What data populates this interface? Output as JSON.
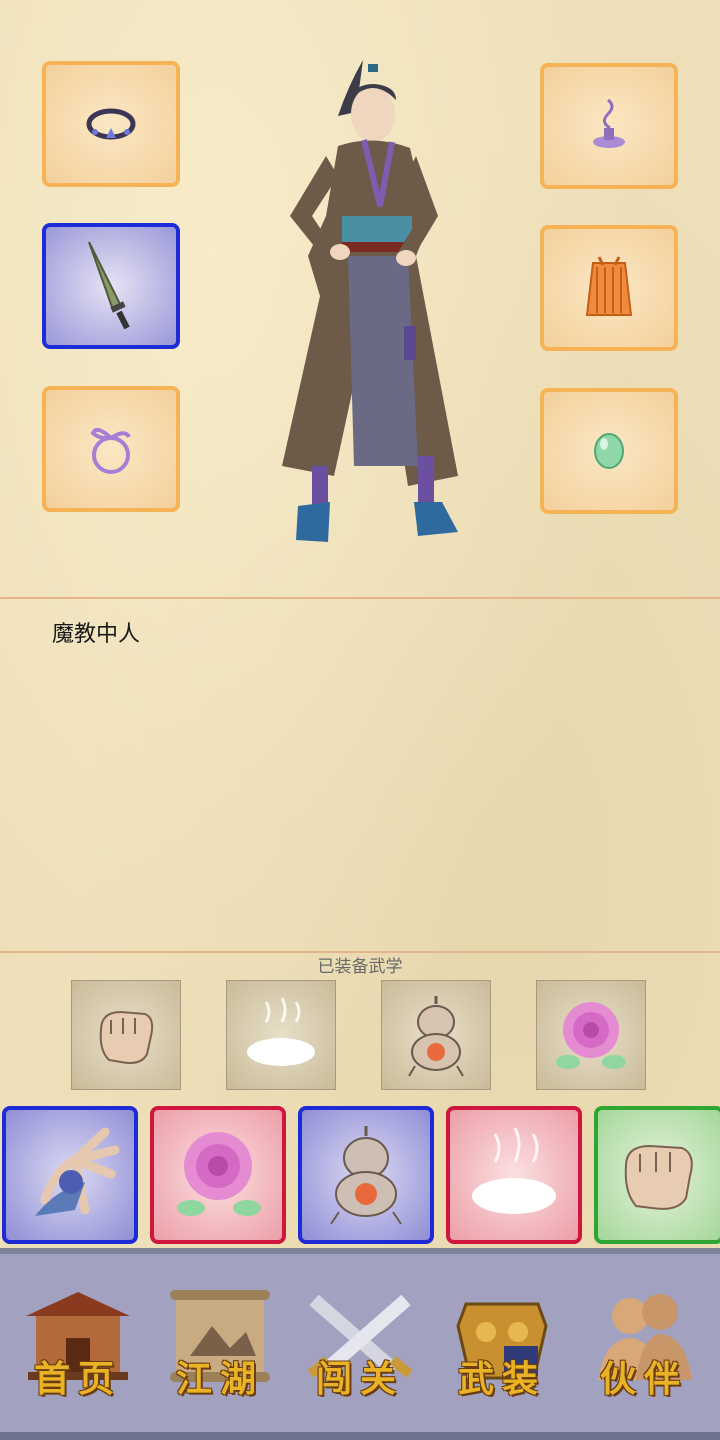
{
  "character": {
    "title": "魔教中人"
  },
  "equipment": {
    "left_slots": [
      {
        "icon": "ring-icon",
        "selected": false
      },
      {
        "icon": "sword-icon",
        "selected": true
      },
      {
        "icon": "ribbon-icon",
        "selected": false
      }
    ],
    "right_slots": [
      {
        "icon": "incense-icon",
        "selected": false
      },
      {
        "icon": "robe-icon",
        "selected": false
      },
      {
        "icon": "jade-bead-icon",
        "selected": false
      }
    ]
  },
  "martial_arts": {
    "label": "已装备武学",
    "equipped": [
      "fist-icon",
      "mist-icon",
      "gourd-icon",
      "peony-icon"
    ]
  },
  "skill_cards": [
    {
      "icon": "claw-hand-icon",
      "frame": "blue"
    },
    {
      "icon": "peony-icon",
      "frame": "red"
    },
    {
      "icon": "gourd-icon",
      "frame": "blue"
    },
    {
      "icon": "mist-icon",
      "frame": "red"
    },
    {
      "icon": "fist-icon",
      "frame": "green"
    }
  ],
  "nav": {
    "items": [
      {
        "label": "首页",
        "icon": "house-icon"
      },
      {
        "label": "江湖",
        "icon": "scroll-map-icon"
      },
      {
        "label": "闯关",
        "icon": "crossed-swords-icon"
      },
      {
        "label": "武装",
        "icon": "armor-icon"
      },
      {
        "label": "伙伴",
        "icon": "partners-icon"
      }
    ]
  },
  "colors": {
    "slot_border": "#f5b355",
    "selected_border": "#1c2dd8",
    "nav_label": "#e9b325",
    "nav_bg": "#a2a2c0"
  }
}
